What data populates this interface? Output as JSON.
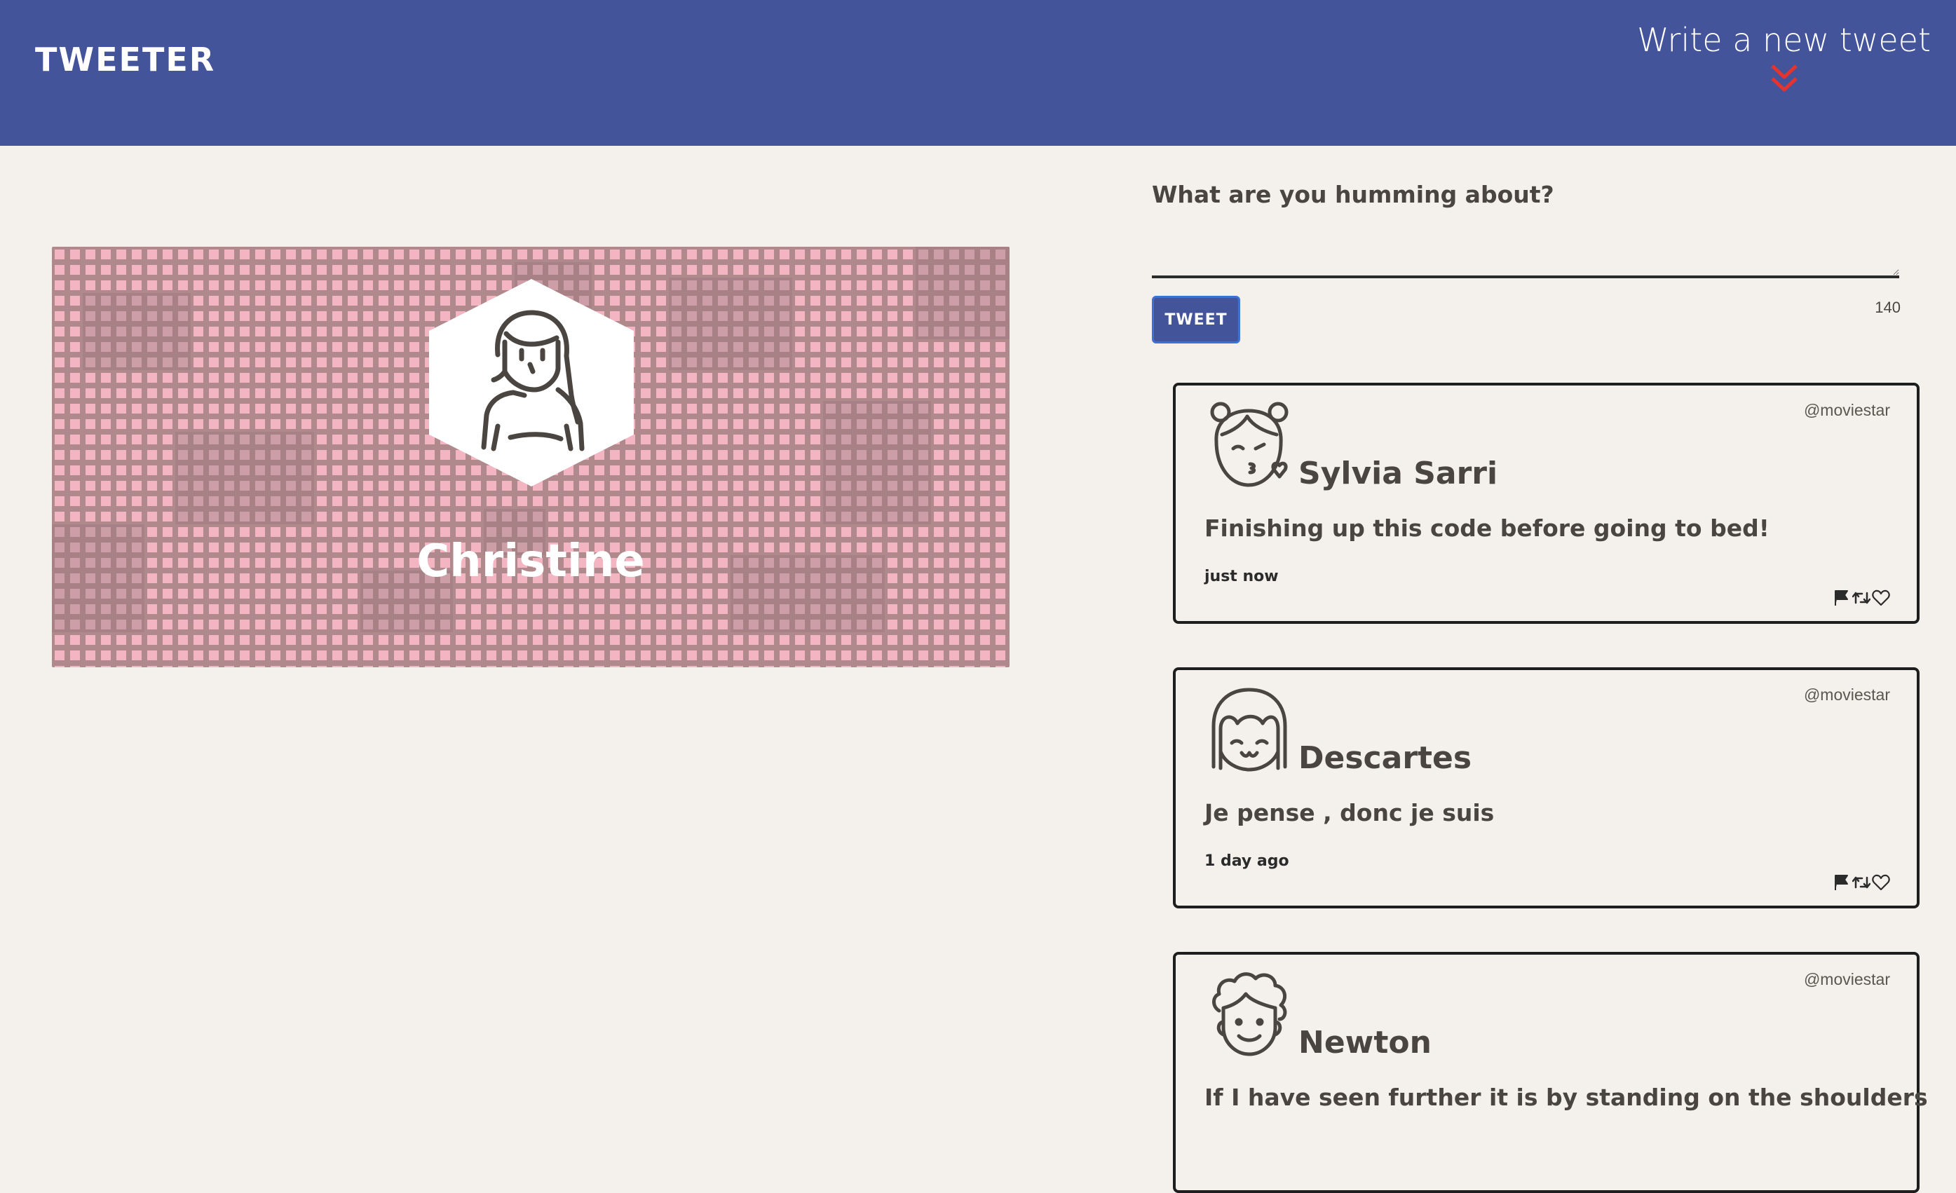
{
  "nav": {
    "brand": "TWEETER",
    "compose_label": "Write a new tweet",
    "accent_color": "#e3342f",
    "background_color": "#44549b"
  },
  "profile": {
    "name": "Christine",
    "pattern_color": "#c9a0a7"
  },
  "compose": {
    "prompt": "What are you humming about?",
    "textarea_value": "",
    "button_label": "TWEET",
    "char_counter": "140"
  },
  "tweets": [
    {
      "avatar_icon": "girl-blowing-kiss-icon",
      "name": "Sylvia Sarri",
      "handle": "@moviestar",
      "content": "Finishing up this code before going to bed!",
      "time": "just now"
    },
    {
      "avatar_icon": "girl-bangs-smiling-icon",
      "name": "Descartes",
      "handle": "@moviestar",
      "content": "Je pense , donc je suis",
      "time": "1 day ago"
    },
    {
      "avatar_icon": "curly-hair-man-icon",
      "name": "Newton",
      "handle": "@moviestar",
      "content": "If I have seen further it is by standing on the shoulders",
      "time": ""
    }
  ]
}
